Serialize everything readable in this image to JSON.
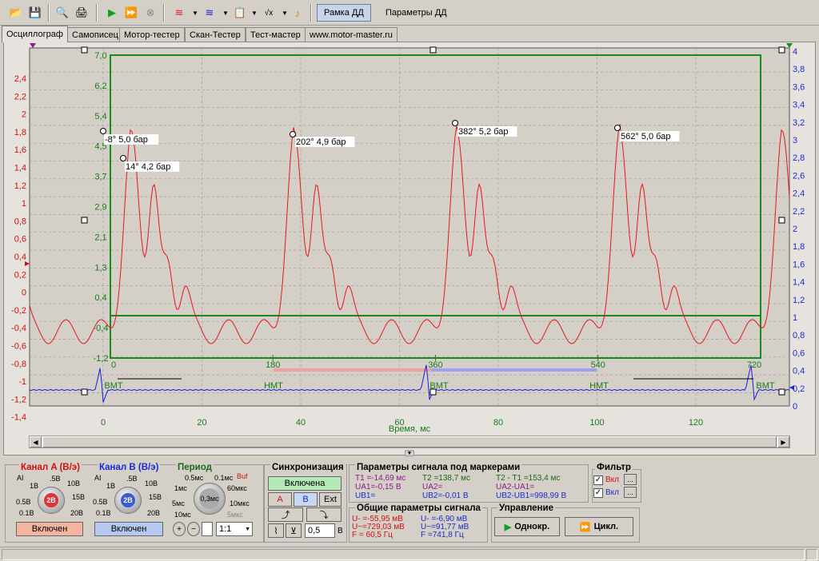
{
  "toolbar": {
    "frame_button": "Рамка ДД",
    "params_button": "Параметры ДД"
  },
  "tabs": [
    "Осциллограф",
    "Самописец",
    "Мотор-тестер",
    "Скан-Тестер",
    "Тест-мастер",
    "www.motor-master.ru"
  ],
  "chart_data": {
    "type": "line",
    "xlabel": "Время, мс",
    "x_ticks": [
      "0",
      "20",
      "40",
      "60",
      "80",
      "100",
      "120"
    ],
    "left_axis_ticks": [
      "2,4",
      "2,2",
      "2",
      "1,8",
      "1,6",
      "1,4",
      "1,2",
      "1",
      "0,8",
      "0,6",
      "0,4",
      "0,2",
      "0",
      "-0,2",
      "-0,4",
      "-0,6",
      "-0,8",
      "-1",
      "-1,2",
      "-1,4"
    ],
    "right_axis_ticks": [
      "4",
      "3,8",
      "3,6",
      "3,4",
      "3,2",
      "3",
      "2,8",
      "2,6",
      "2,4",
      "2,2",
      "2",
      "1,8",
      "1,6",
      "1,4",
      "1,2",
      "1",
      "0,8",
      "0,6",
      "0,4",
      "0,2",
      "0"
    ],
    "pressure_axis_ticks": [
      "7,0",
      "6,2",
      "5,4",
      "4,5",
      "3,7",
      "2,9",
      "2,1",
      "1,3",
      "0,4",
      "-0,4",
      "-1,2"
    ],
    "degree_ticks": [
      "0",
      "180",
      "360",
      "540",
      "720"
    ],
    "markers_bottom": [
      "ВМТ",
      "НМТ",
      "ВМТ",
      "НМТ",
      "ВМТ"
    ],
    "peak_labels": [
      "-8° 5,0 бар",
      "14° 4,2 бар",
      "202° 4,9 бар",
      "382° 5,2 бар",
      "562° 5,0 бар"
    ],
    "series": [
      {
        "name": "Канал A",
        "color": "#e8141e"
      },
      {
        "name": "Канал B",
        "color": "#1a1ae0"
      }
    ]
  },
  "channel_a": {
    "title": "Канал A (В/э)",
    "value": "2В",
    "scale": [
      "1В",
      ".5В",
      "10В",
      "0.5В",
      "15В",
      "0.1В",
      "20В"
    ],
    "button": "Включен"
  },
  "channel_b": {
    "title": "Канал B (В/э)",
    "value": "2В",
    "scale": [
      "1В",
      ".5В",
      "10В",
      "0.5В",
      "15В",
      "0.1В",
      "20В"
    ],
    "button": "Включен"
  },
  "period": {
    "title": "Период",
    "value": "0,3мс",
    "scale": [
      "0.5мс",
      "0.1мс",
      "1мс",
      "60мкс",
      "5мс",
      "10мкс",
      "10мс",
      "5мкс"
    ],
    "buf": "Buf",
    "ratio": "1:1"
  },
  "sync": {
    "title": "Синхронизация",
    "button": "Включена",
    "a": "A",
    "b": "B",
    "ext": "Ext",
    "level": "0,5",
    "unit": "В"
  },
  "markers": {
    "title": "Параметры сигнала под маркерами",
    "t1": "T1 =-14,69 мс",
    "t2": "T2 =138,7 мс",
    "dt": "T2 - T1 =153,4 мс",
    "ua1": "UA1=-0,15 В",
    "ua2": "UA2=",
    "ua21": "UA2-UA1=",
    "ub1": "UB1=",
    "ub2": "UB2=-0,01 В",
    "ub21": "UB2-UB1=998,99 В"
  },
  "general": {
    "title": "Общие параметры сигнала",
    "a_min": "U- =-55,95 мВ",
    "a_max": "U~=729,03 мВ",
    "a_f": "F = 60,5 Гц",
    "b_min": "U- =-6,90 мВ",
    "b_max": "U~=91,77 мВ",
    "b_f": "F =741,8 Гц"
  },
  "filter": {
    "title": "Фильтр",
    "on1": "Вкл",
    "on2": "Вкл"
  },
  "control": {
    "title": "Управление",
    "single": "Однокр.",
    "cycle": "Цикл."
  }
}
